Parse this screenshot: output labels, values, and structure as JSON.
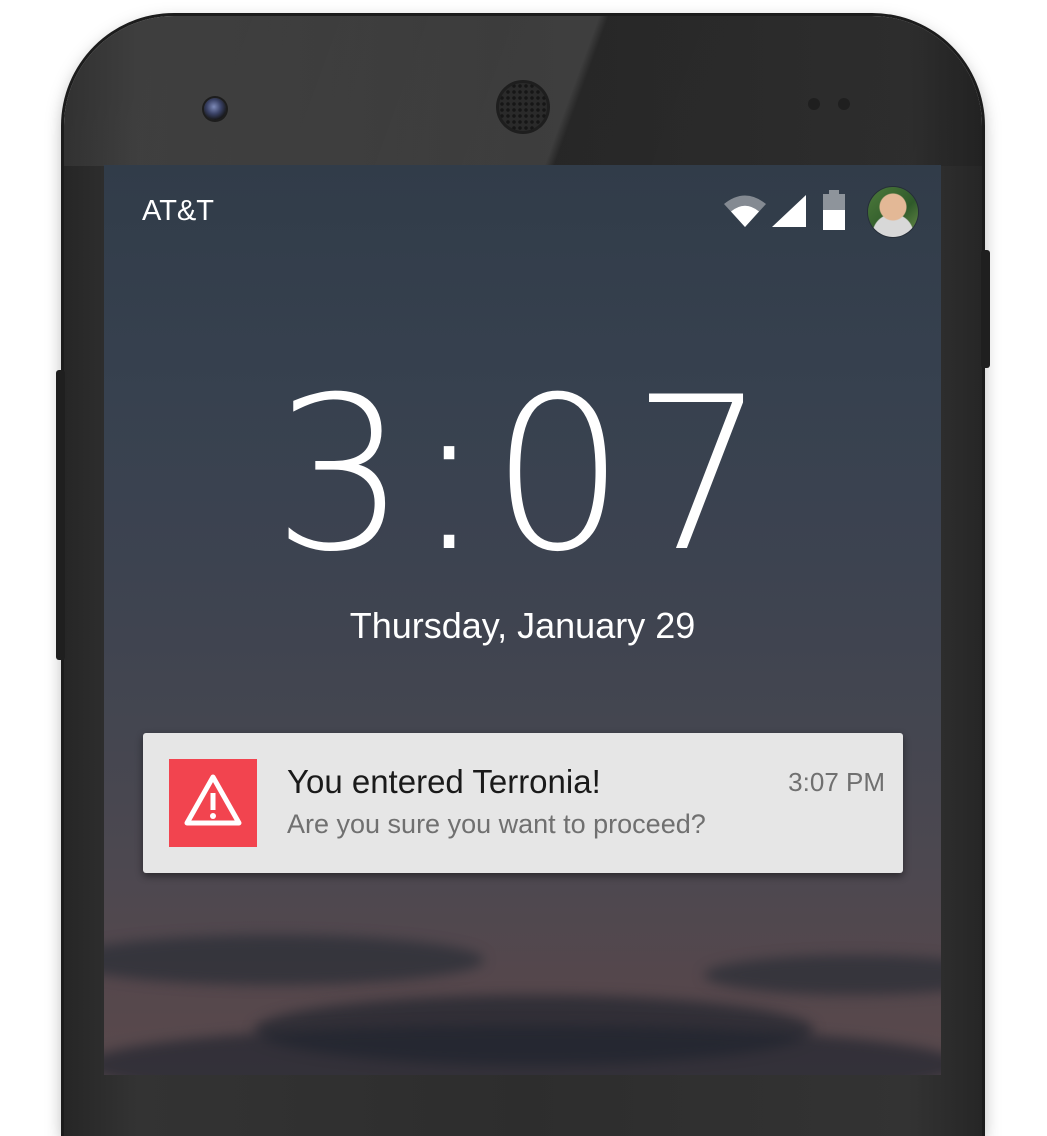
{
  "status_bar": {
    "carrier": "AT&T",
    "icons": [
      "wifi-icon",
      "signal-icon",
      "battery-icon",
      "avatar"
    ]
  },
  "lockscreen": {
    "time": "3:07",
    "date": "Thursday, January 29"
  },
  "notification": {
    "icon": "warning-icon",
    "icon_color": "#f2444f",
    "title": "You entered Terronia!",
    "body": "Are you sure you want to proceed?",
    "time": "3:07 PM"
  }
}
